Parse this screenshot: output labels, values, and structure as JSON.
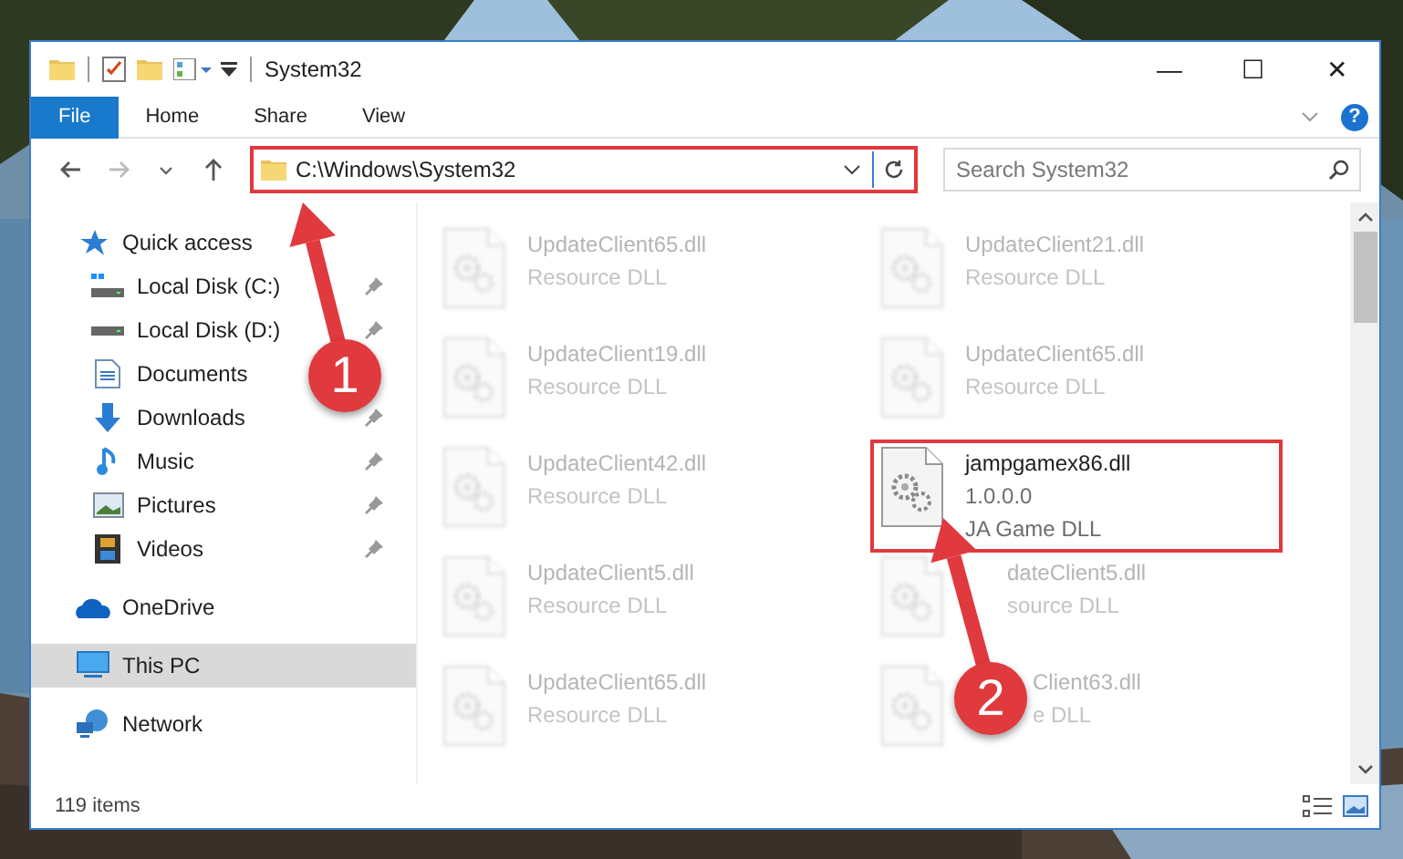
{
  "window": {
    "title": "System32",
    "controls": [
      "—",
      "☐",
      "✕"
    ]
  },
  "ribbon": {
    "tabs": [
      {
        "label": "File",
        "kind": "file",
        "selected": false
      },
      {
        "label": "Home",
        "kind": "tab",
        "selected": false
      },
      {
        "label": "Share",
        "kind": "tab",
        "selected": false
      },
      {
        "label": "View",
        "kind": "tab",
        "selected": false
      }
    ]
  },
  "help_button": {
    "label": "?"
  },
  "address_bar": {
    "path": "C:\\Windows\\System32",
    "highlighted": true
  },
  "search": {
    "placeholder": "Search System32"
  },
  "sidebar": {
    "items": [
      {
        "label": "Quick access",
        "kind": "star",
        "selected": false,
        "children": [
          {
            "label": "Local Disk (C:)",
            "kind": "drive-c",
            "pinned": true,
            "selected": false
          },
          {
            "label": "Local Disk (D:)",
            "kind": "drive",
            "pinned": true,
            "selected": false
          },
          {
            "label": "Documents",
            "kind": "documents",
            "pinned": false,
            "selected": false
          },
          {
            "label": "Downloads",
            "kind": "downloads",
            "pinned": true,
            "selected": false
          },
          {
            "label": "Music",
            "kind": "music",
            "pinned": true,
            "selected": false
          },
          {
            "label": "Pictures",
            "kind": "pictures",
            "pinned": true,
            "selected": false
          },
          {
            "label": "Videos",
            "kind": "videos",
            "pinned": true,
            "selected": false
          }
        ]
      },
      {
        "label": "OneDrive",
        "kind": "cloud",
        "selected": false
      },
      {
        "label": "This PC",
        "kind": "computer",
        "selected": true
      },
      {
        "label": "Network",
        "kind": "network",
        "selected": false
      }
    ]
  },
  "files": [
    {
      "kind": "blurred",
      "name": "UpdateClient65.dll",
      "details": [
        "Resource DLL"
      ],
      "highlighted": false
    },
    {
      "kind": "blurred",
      "name": "UpdateClient21.dll",
      "details": [
        "Resource DLL"
      ],
      "highlighted": false
    },
    {
      "kind": "blurred",
      "name": "UpdateClient19.dll",
      "details": [
        "Resource DLL"
      ],
      "highlighted": false
    },
    {
      "kind": "blurred",
      "name": "UpdateClient65.dll",
      "details": [
        "Resource DLL"
      ],
      "highlighted": false
    },
    {
      "kind": "blurred",
      "name": "UpdateClient42.dll",
      "details": [
        "Resource DLL"
      ],
      "highlighted": false
    },
    {
      "kind": "clear",
      "name": "jampgamex86.dll",
      "details": [
        "1.0.0.0",
        "JA Game DLL"
      ],
      "highlighted": true
    },
    {
      "kind": "blurred",
      "name": "UpdateClient5.dll",
      "details": [
        "Resource DLL"
      ],
      "highlighted": false
    },
    {
      "kind": "covered",
      "name": "dateClient5.dll",
      "details": [
        "source DLL"
      ],
      "highlighted": false
    },
    {
      "kind": "blurred",
      "name": "UpdateClient65.dll",
      "details": [
        "Resource DLL"
      ],
      "highlighted": false
    },
    {
      "kind": "covered-more",
      "name": "Client63.dll",
      "details": [
        "e DLL"
      ],
      "highlighted": false
    }
  ],
  "status_bar": {
    "item_count": "119 items"
  },
  "callouts": [
    {
      "number": "1"
    },
    {
      "number": "2"
    }
  ]
}
